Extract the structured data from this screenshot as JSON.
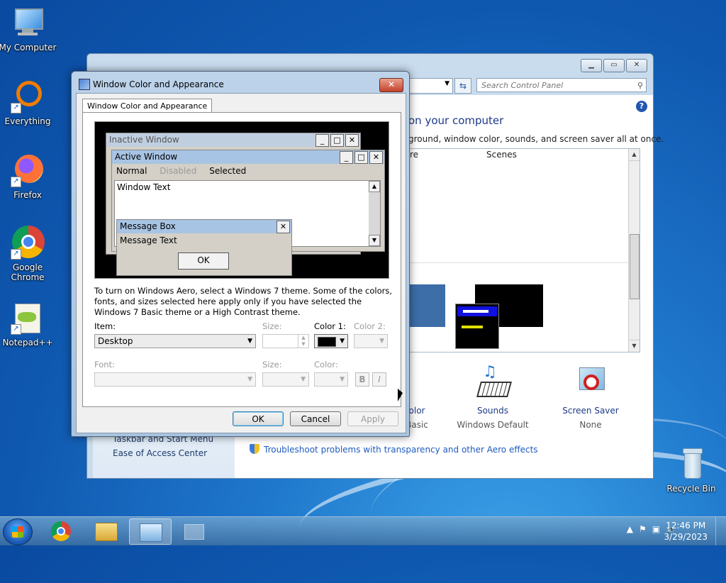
{
  "desktop": {
    "icons": [
      {
        "label": "My Computer"
      },
      {
        "label": "Everything"
      },
      {
        "label": "Firefox"
      },
      {
        "label": "Google Chrome"
      },
      {
        "label": "Notepad++"
      },
      {
        "label": "Recycle Bin"
      }
    ]
  },
  "control_panel": {
    "search_placeholder": "Search Control Panel",
    "heading": "on your computer",
    "subheading": "ground, window color, sounds, and screen saver all at once.",
    "column_re": "re",
    "column_scenes": "Scenes",
    "left_links": [
      "Taskbar and Start Menu",
      "Ease of Access Center"
    ],
    "options": [
      {
        "label": "olor",
        "sub": "Basic"
      },
      {
        "label": "Sounds",
        "sub": "Windows Default"
      },
      {
        "label": "Screen Saver",
        "sub": "None"
      }
    ],
    "troubleshoot": "Troubleshoot problems with transparency and other Aero effects"
  },
  "dialog": {
    "title": "Window Color and Appearance",
    "tab": "Window Color and Appearance",
    "preview": {
      "inactive_title": "Inactive Window",
      "active_title": "Active Window",
      "menu_normal": "Normal",
      "menu_disabled": "Disabled",
      "menu_selected": "Selected",
      "window_text": "Window Text",
      "msgbox_title": "Message Box",
      "msgbox_text": "Message Text",
      "msgbox_ok": "OK"
    },
    "description": "To turn on Windows Aero, select a Windows 7 theme.  Some of the colors, fonts, and sizes selected here apply only if you have selected the Windows 7 Basic theme or a High Contrast theme.",
    "item_label": "Item:",
    "item_value": "Desktop",
    "size_label": "Size:",
    "color1_label": "Color 1:",
    "color1_value": "#000000",
    "color2_label": "Color 2:",
    "font_label": "Font:",
    "font_size_label": "Size:",
    "font_color_label": "Color:",
    "bold_label": "B",
    "italic_label": "I",
    "ok": "OK",
    "cancel": "Cancel",
    "apply": "Apply"
  },
  "taskbar": {
    "time": "12:46 PM",
    "date": "3/29/2023"
  }
}
